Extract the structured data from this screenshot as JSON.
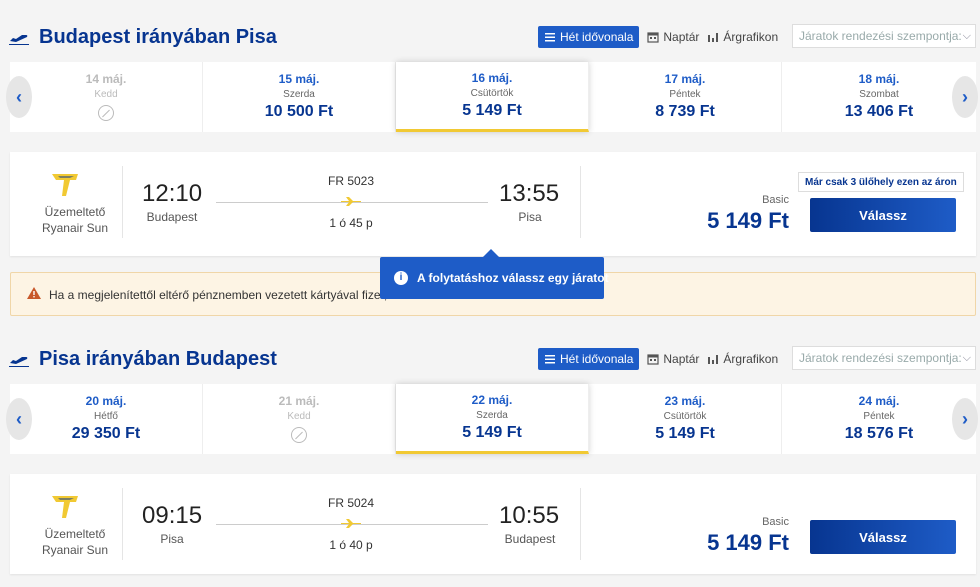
{
  "view_tabs": {
    "week": "Hét idővonala",
    "calendar": "Naptár",
    "chart": "Árgrafikon"
  },
  "sort_placeholder": "Járatok rendezési szempontja:",
  "outbound": {
    "title": "Budapest irányában Pisa",
    "dates": [
      {
        "date": "14 máj.",
        "weekday": "Kedd",
        "price": "",
        "available": false
      },
      {
        "date": "15 máj.",
        "weekday": "Szerda",
        "price": "10 500 Ft",
        "available": true
      },
      {
        "date": "16 máj.",
        "weekday": "Csütörtök",
        "price": "5 149 Ft",
        "available": true,
        "selected": true
      },
      {
        "date": "17 máj.",
        "weekday": "Péntek",
        "price": "8 739 Ft",
        "available": true
      },
      {
        "date": "18 máj.",
        "weekday": "Szombat",
        "price": "13 406 Ft",
        "available": true
      }
    ],
    "flight": {
      "operator_label": "Üzemeltető",
      "operator": "Ryanair Sun",
      "dep_time": "12:10",
      "dep_city": "Budapest",
      "arr_time": "13:55",
      "arr_city": "Pisa",
      "flight_no": "FR 5023",
      "duration": "1 ó 45 p",
      "fare": "Basic",
      "price": "5 149 Ft",
      "seats_notice": "Már csak 3 ülőhely ezen az áron",
      "select_label": "Válassz"
    }
  },
  "warning_text": "Ha a megjelenítettől eltérő pénznemben vezetett kártyával fizet, a",
  "tooltip_text": "A folytatáshoz válassz egy járatot",
  "inbound": {
    "title": "Pisa irányában Budapest",
    "dates": [
      {
        "date": "20 máj.",
        "weekday": "Hétfő",
        "price": "29 350 Ft",
        "available": true
      },
      {
        "date": "21 máj.",
        "weekday": "Kedd",
        "price": "",
        "available": false
      },
      {
        "date": "22 máj.",
        "weekday": "Szerda",
        "price": "5 149 Ft",
        "available": true,
        "selected": true
      },
      {
        "date": "23 máj.",
        "weekday": "Csütörtök",
        "price": "5 149 Ft",
        "available": true
      },
      {
        "date": "24 máj.",
        "weekday": "Péntek",
        "price": "18 576 Ft",
        "available": true
      }
    ],
    "flight": {
      "operator_label": "Üzemeltető",
      "operator": "Ryanair Sun",
      "dep_time": "09:15",
      "dep_city": "Pisa",
      "arr_time": "10:55",
      "arr_city": "Budapest",
      "flight_no": "FR 5024",
      "duration": "1 ó 40 p",
      "fare": "Basic",
      "price": "5 149 Ft",
      "select_label": "Válassz"
    }
  },
  "colors": {
    "brand": "#073590",
    "accent": "#1e5cc7",
    "highlight": "#f1c933"
  },
  "icons": {
    "arrow_left": "‹",
    "arrow_right": "›",
    "chevron": "⌵",
    "info": "i"
  }
}
